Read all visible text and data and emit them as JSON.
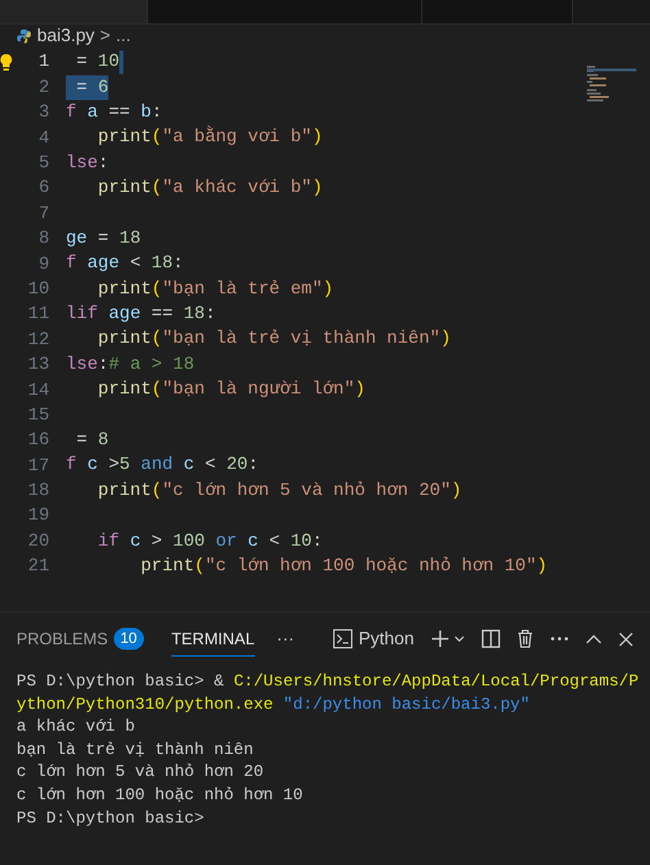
{
  "editor_tabs": [
    {
      "selected": true
    },
    {
      "selected": false
    },
    {
      "selected": false
    }
  ],
  "breadcrumb": {
    "file": "bai3.py",
    "separator": ">",
    "rest": "..."
  },
  "code_lines": [
    {
      "number": "1",
      "cursor": true,
      "selected": false,
      "tokens": [
        {
          "t": " = ",
          "kind": "op"
        },
        {
          "t": "10",
          "kind": "num"
        }
      ]
    },
    {
      "number": "2",
      "cursor": false,
      "selected": true,
      "tokens": [
        {
          "t": " = ",
          "kind": "op"
        },
        {
          "t": "6",
          "kind": "num"
        }
      ]
    },
    {
      "number": "3",
      "cursor": false,
      "selected": false,
      "tokens": [
        {
          "t": "f ",
          "kind": "keyword"
        },
        {
          "t": "a",
          "kind": "var"
        },
        {
          "t": " == ",
          "kind": "op"
        },
        {
          "t": "b",
          "kind": "var"
        },
        {
          "t": ":",
          "kind": "op"
        }
      ]
    },
    {
      "number": "4",
      "cursor": false,
      "selected": false,
      "tokens": [
        {
          "t": "   print",
          "kind": "func"
        },
        {
          "t": "(",
          "kind": "paren"
        },
        {
          "t": "\"a bằng vơi b\"",
          "kind": "str"
        },
        {
          "t": ")",
          "kind": "paren"
        }
      ]
    },
    {
      "number": "5",
      "cursor": false,
      "selected": false,
      "tokens": [
        {
          "t": "lse",
          "kind": "keyword"
        },
        {
          "t": ":",
          "kind": "op"
        }
      ]
    },
    {
      "number": "6",
      "cursor": false,
      "selected": false,
      "tokens": [
        {
          "t": "   print",
          "kind": "func"
        },
        {
          "t": "(",
          "kind": "paren"
        },
        {
          "t": "\"a khác với b\"",
          "kind": "str"
        },
        {
          "t": ")",
          "kind": "paren"
        }
      ]
    },
    {
      "number": "7",
      "cursor": false,
      "selected": false
    },
    {
      "number": "8",
      "cursor": false,
      "selected": false,
      "tokens": [
        {
          "t": "ge",
          "kind": "var"
        },
        {
          "t": " = ",
          "kind": "op"
        },
        {
          "t": "18",
          "kind": "num"
        }
      ]
    },
    {
      "number": "9",
      "cursor": false,
      "selected": false,
      "tokens": [
        {
          "t": "f ",
          "kind": "keyword"
        },
        {
          "t": "age",
          "kind": "var"
        },
        {
          "t": " < ",
          "kind": "op"
        },
        {
          "t": "18",
          "kind": "num"
        },
        {
          "t": ":",
          "kind": "op"
        }
      ]
    },
    {
      "number": "10",
      "cursor": false,
      "selected": false,
      "tokens": [
        {
          "t": "   print",
          "kind": "func"
        },
        {
          "t": "(",
          "kind": "paren"
        },
        {
          "t": "\"bạn là trẻ em\"",
          "kind": "str"
        },
        {
          "t": ")",
          "kind": "paren"
        }
      ]
    },
    {
      "number": "11",
      "cursor": false,
      "selected": false,
      "tokens": [
        {
          "t": "lif ",
          "kind": "keyword"
        },
        {
          "t": "age",
          "kind": "var"
        },
        {
          "t": " == ",
          "kind": "op"
        },
        {
          "t": "18",
          "kind": "num"
        },
        {
          "t": ":",
          "kind": "op"
        }
      ]
    },
    {
      "number": "12",
      "cursor": false,
      "selected": false,
      "tokens": [
        {
          "t": "   print",
          "kind": "func"
        },
        {
          "t": "(",
          "kind": "paren"
        },
        {
          "t": "\"bạn là trẻ vị thành niên\"",
          "kind": "str"
        },
        {
          "t": ")",
          "kind": "paren"
        }
      ]
    },
    {
      "number": "13",
      "cursor": false,
      "selected": false,
      "tokens": [
        {
          "t": "lse",
          "kind": "keyword"
        },
        {
          "t": ":",
          "kind": "op"
        },
        {
          "t": "# a > 18",
          "kind": "comment"
        }
      ]
    },
    {
      "number": "14",
      "cursor": false,
      "selected": false,
      "tokens": [
        {
          "t": "   print",
          "kind": "func"
        },
        {
          "t": "(",
          "kind": "paren"
        },
        {
          "t": "\"bạn là người lớn\"",
          "kind": "str"
        },
        {
          "t": ")",
          "kind": "paren"
        }
      ]
    },
    {
      "number": "15",
      "cursor": false,
      "selected": false
    },
    {
      "number": "16",
      "cursor": false,
      "selected": false,
      "tokens": [
        {
          "t": " = ",
          "kind": "op"
        },
        {
          "t": "8",
          "kind": "num"
        }
      ]
    },
    {
      "number": "17",
      "cursor": false,
      "selected": false,
      "tokens": [
        {
          "t": "f ",
          "kind": "keyword"
        },
        {
          "t": "c",
          "kind": "var"
        },
        {
          "t": " >",
          "kind": "op"
        },
        {
          "t": "5",
          "kind": "num"
        },
        {
          "t": " and ",
          "kind": "logic"
        },
        {
          "t": "c",
          "kind": "var"
        },
        {
          "t": " < ",
          "kind": "op"
        },
        {
          "t": "20",
          "kind": "num"
        },
        {
          "t": ":",
          "kind": "op"
        }
      ]
    },
    {
      "number": "18",
      "cursor": false,
      "selected": false,
      "tokens": [
        {
          "t": "   print",
          "kind": "func"
        },
        {
          "t": "(",
          "kind": "paren"
        },
        {
          "t": "\"c lớn hơn 5 và nhỏ hơn 20\"",
          "kind": "str"
        },
        {
          "t": ")",
          "kind": "paren"
        }
      ]
    },
    {
      "number": "19",
      "cursor": false,
      "selected": false
    },
    {
      "number": "20",
      "cursor": false,
      "selected": false,
      "tokens": [
        {
          "t": "   if ",
          "kind": "keyword"
        },
        {
          "t": "c",
          "kind": "var"
        },
        {
          "t": " > ",
          "kind": "op"
        },
        {
          "t": "100",
          "kind": "num"
        },
        {
          "t": " or ",
          "kind": "logic"
        },
        {
          "t": "c",
          "kind": "var"
        },
        {
          "t": " < ",
          "kind": "op"
        },
        {
          "t": "10",
          "kind": "num"
        },
        {
          "t": ":",
          "kind": "op"
        }
      ]
    },
    {
      "number": "21",
      "cursor": false,
      "selected": false,
      "tokens": [
        {
          "t": "       print",
          "kind": "func"
        },
        {
          "t": "(",
          "kind": "paren"
        },
        {
          "t": "\"c lớn hơn 100 hoặc nhỏ hơn 10\"",
          "kind": "str"
        },
        {
          "t": ")",
          "kind": "paren"
        }
      ]
    }
  ],
  "panel_tabs": [
    {
      "label": "PROBLEMS",
      "badge": "10",
      "selected": false
    },
    {
      "label": "TERMINAL",
      "selected": true
    }
  ],
  "panel_more": "···",
  "terminal_profile": "Python",
  "terminal": {
    "command": [
      {
        "t": "PS D:\\python basic> & ",
        "kind": "plain"
      },
      {
        "t": "C:/Users/hnstore/AppData/Local/Programs/Python/Python310/python.exe",
        "kind": "path"
      },
      {
        "t": "\"d:/python basic/bai3.py\"",
        "kind": "arg"
      }
    ],
    "output": [
      "a khác với b",
      "bạn là trẻ vị thành niên",
      "c lớn hơn 5 và nhỏ hơn 20",
      "c lớn hơn 100 hoặc nhỏ hơn 10",
      "PS D:\\python basic>"
    ]
  }
}
